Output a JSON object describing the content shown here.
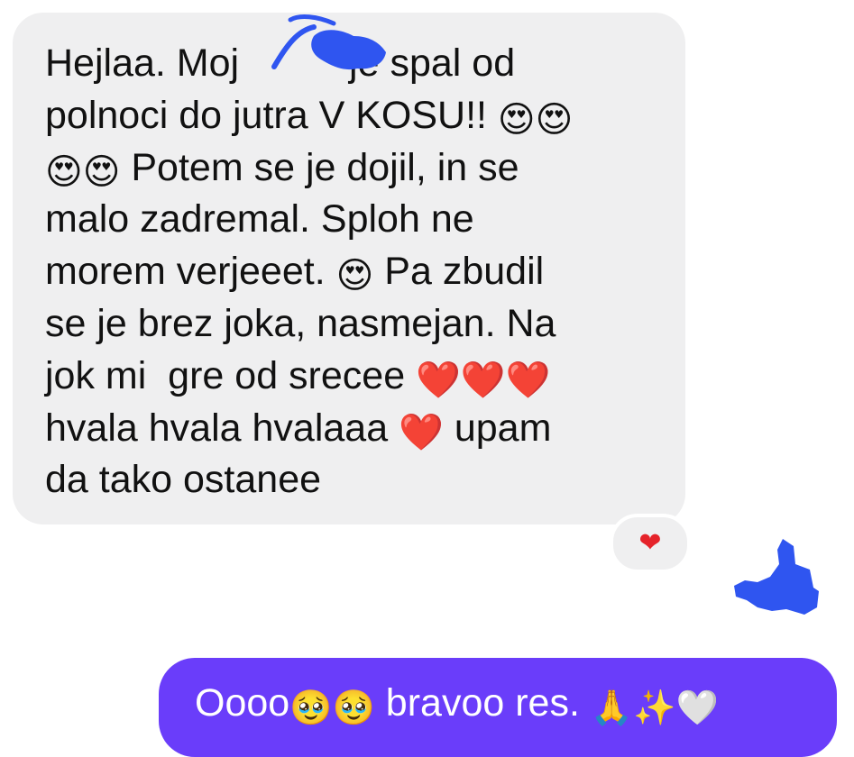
{
  "incoming_message": {
    "lines": [
      "Hejlaa. Moj ",
      "je spal od",
      "polnoci do jutra V KOSU!!",
      "Potem se je dojil, in se",
      "malo zadremal. Sploh ne",
      "morem verjeeet.",
      "Pa zbudil",
      "se je brez joka, nasmejan. Na",
      "jok mi  gre od srecee",
      "hvala hvala hvalaaa",
      "upam",
      "da tako ostanee"
    ],
    "emoji": {
      "heart_eyes": "😍",
      "red_heart": "❤️"
    }
  },
  "reaction": {
    "emoji": "❤"
  },
  "outgoing_message": {
    "text_start": "Oooo",
    "emoji_pleading": "🥹",
    "text_mid": " bravoo res. ",
    "emoji_pray": "🙏",
    "emoji_sparkles": "✨",
    "emoji_white_heart": "🤍"
  },
  "colors": {
    "incoming_bubble": "#efeff0",
    "outgoing_bubble": "#6a3dfa",
    "redaction": "#2f55f0",
    "reaction_heart": "#e5232a"
  }
}
